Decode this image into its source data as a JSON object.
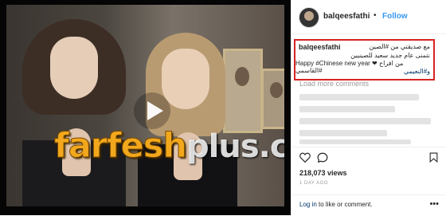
{
  "post": {
    "username": "balqeesfathi",
    "separator": "•",
    "follow_label": "Follow"
  },
  "caption": {
    "username": "balqeesfathi",
    "line1": "مع صديقتي من #الصين",
    "line2": "نتمنى عام جديد سعيد للصينيين",
    "line3": "Happy #Chinese new year ❤ من افراح #القاسمي",
    "line4": "و#النعيمي",
    "highlight_color": "#d62323"
  },
  "comments": {
    "load_more_label": "Load more comments"
  },
  "stats": {
    "views": "218,073 views",
    "time_ago": "1 DAY AGO"
  },
  "footer": {
    "log_in": "Log in",
    "rest": " to like or comment.",
    "more_icon": "•••"
  },
  "video": {
    "watermark_part1": "farfesh",
    "watermark_part2": "plus.com"
  },
  "icons": [
    "heart-icon",
    "comment-icon",
    "bookmark-icon",
    "play-icon",
    "more-options-icon"
  ],
  "colors": {
    "link": "#3897f0",
    "hashtag": "#003569",
    "text": "#262626",
    "muted": "#999999",
    "watermark": "#f2a81d"
  }
}
